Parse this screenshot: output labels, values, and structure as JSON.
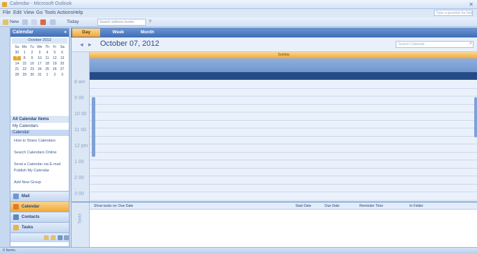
{
  "window": {
    "title": "Calendar - Microsoft Outlook"
  },
  "menu": [
    "File",
    "Edit",
    "View",
    "Go",
    "Tools",
    "Actions",
    "Help"
  ],
  "help_search": {
    "placeholder": "Type a question for help"
  },
  "toolbar": {
    "new_label": "New",
    "today_label": "Today",
    "search_combo": "Search address books"
  },
  "nav": {
    "header": "Calendar",
    "minical": {
      "month": "October 2012",
      "weekdays": [
        "Su",
        "Mo",
        "Tu",
        "We",
        "Th",
        "Fr",
        "Sa"
      ],
      "days": [
        "30",
        "1",
        "2",
        "3",
        "4",
        "5",
        "6",
        "7",
        "8",
        "9",
        "10",
        "11",
        "12",
        "13",
        "14",
        "15",
        "16",
        "17",
        "18",
        "19",
        "20",
        "21",
        "22",
        "23",
        "24",
        "25",
        "26",
        "27",
        "28",
        "29",
        "30",
        "31",
        "1",
        "2",
        "3"
      ],
      "today_index": 7
    },
    "section_title": "All Calendar Items",
    "list": [
      "My Calendars",
      "Calendar"
    ],
    "links": [
      "How to Share Calendars",
      "Search Calendars Online",
      "Send a Calendar via E-mail",
      "Publish My Calendar",
      "Add New Group"
    ],
    "buttons": [
      "Mail",
      "Calendar",
      "Contacts",
      "Tasks"
    ],
    "active_button": "Calendar"
  },
  "view_tabs": [
    "Day",
    "Week",
    "Month"
  ],
  "active_tab": "Day",
  "calendar": {
    "date_heading": "October 07, 2012",
    "search_placeholder": "Search Calendar",
    "day_header": "Sunday",
    "times": [
      "8 am",
      "9 00",
      "10 00",
      "11 00",
      "12 pm",
      "1 00",
      "2 00",
      "3 00"
    ]
  },
  "tasks": {
    "side_label": "Tasks",
    "columns": [
      "Show tasks on: Due Date",
      "Start Date",
      "Due Date",
      "Reminder Time",
      "In Folder"
    ]
  },
  "status": {
    "text": "0 Items"
  },
  "colors": {
    "accent": "#f1a73a",
    "header_blue": "#3f6eb5",
    "allday_dark": "#244b86"
  }
}
